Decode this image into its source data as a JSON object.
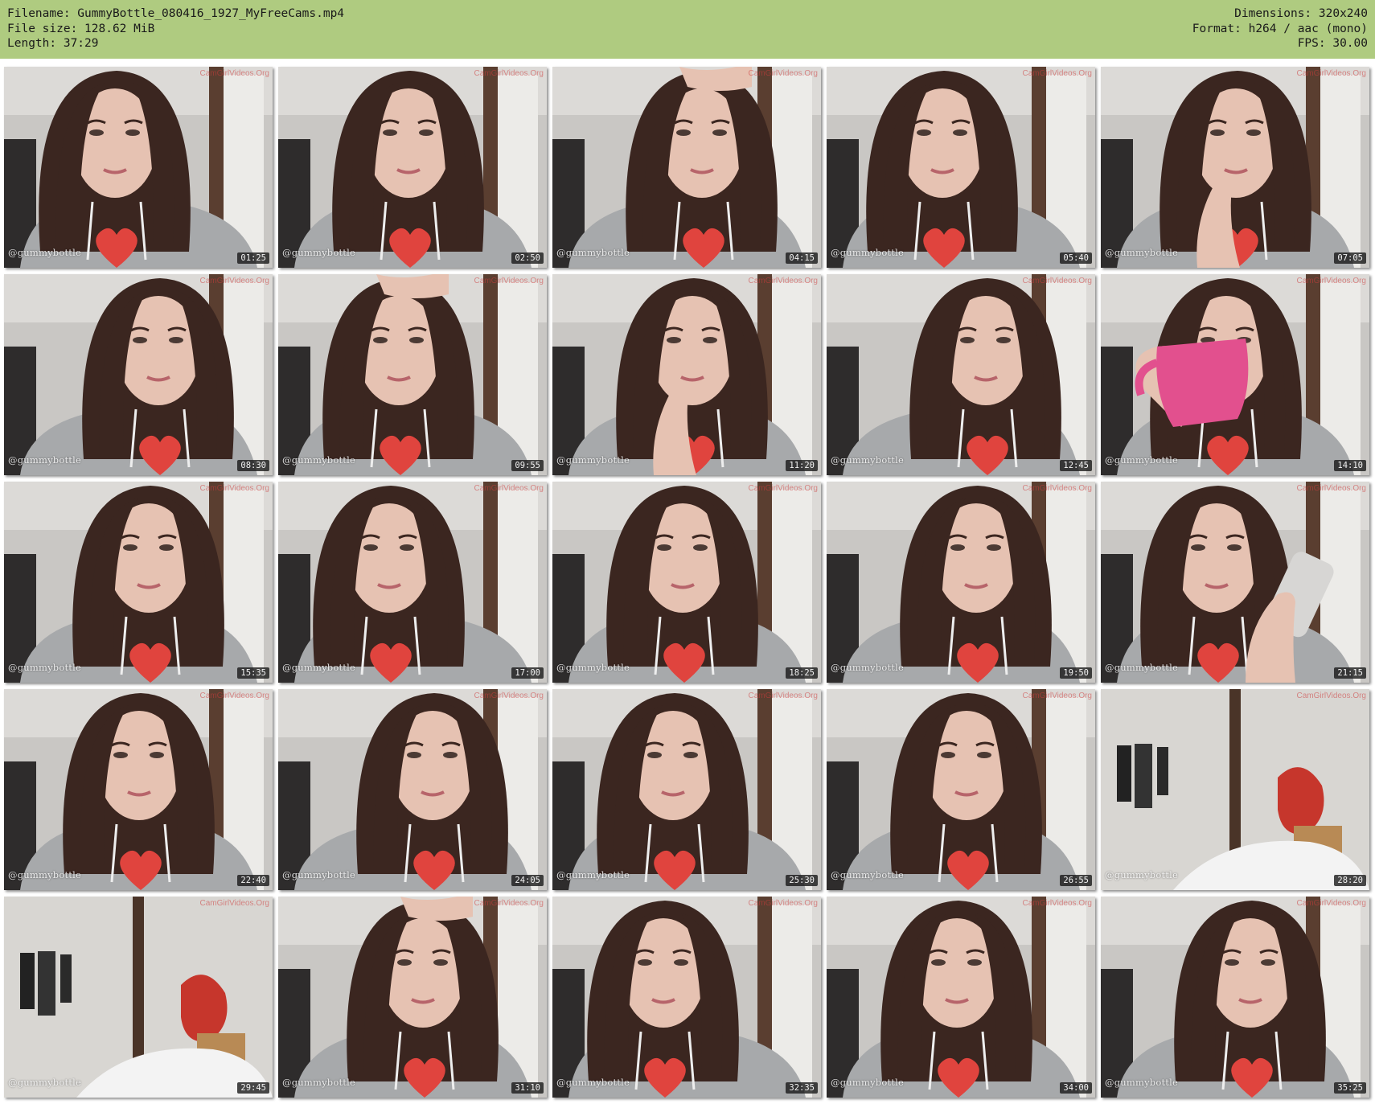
{
  "header": {
    "filename": "Filename: GummyBottle_080416_1927_MyFreeCams.mp4",
    "filesize": "File size: 128.62 MiB",
    "length": "Length: 37:29",
    "dimensions": "Dimensions: 320x240",
    "format": "Format: h264 / aac (mono)",
    "fps": "FPS: 30.00"
  },
  "colors": {
    "header_bg": "#afcb80",
    "hoodie": "#a7a9ab",
    "hair": "#3b2620",
    "skin": "#e6c2b2",
    "heart": "#e0443e",
    "mug": "#e2508e"
  },
  "watermark": "@gummybottle",
  "site_mark": "CamGirlVideos.Org",
  "thumbnails": [
    {
      "time": "01:25",
      "scene": "face"
    },
    {
      "time": "02:50",
      "scene": "face"
    },
    {
      "time": "04:15",
      "scene": "hand-hair"
    },
    {
      "time": "05:40",
      "scene": "face"
    },
    {
      "time": "07:05",
      "scene": "hand-face"
    },
    {
      "time": "08:30",
      "scene": "face"
    },
    {
      "time": "09:55",
      "scene": "hand-hair"
    },
    {
      "time": "11:20",
      "scene": "hand-face"
    },
    {
      "time": "12:45",
      "scene": "face"
    },
    {
      "time": "14:10",
      "scene": "mug"
    },
    {
      "time": "15:35",
      "scene": "face"
    },
    {
      "time": "17:00",
      "scene": "face"
    },
    {
      "time": "18:25",
      "scene": "face"
    },
    {
      "time": "19:50",
      "scene": "face"
    },
    {
      "time": "21:15",
      "scene": "phone"
    },
    {
      "time": "22:40",
      "scene": "face"
    },
    {
      "time": "24:05",
      "scene": "face"
    },
    {
      "time": "25:30",
      "scene": "face"
    },
    {
      "time": "26:55",
      "scene": "face"
    },
    {
      "time": "28:20",
      "scene": "room"
    },
    {
      "time": "29:45",
      "scene": "room"
    },
    {
      "time": "31:10",
      "scene": "hand-hair"
    },
    {
      "time": "32:35",
      "scene": "face"
    },
    {
      "time": "34:00",
      "scene": "face"
    },
    {
      "time": "35:25",
      "scene": "face"
    }
  ]
}
